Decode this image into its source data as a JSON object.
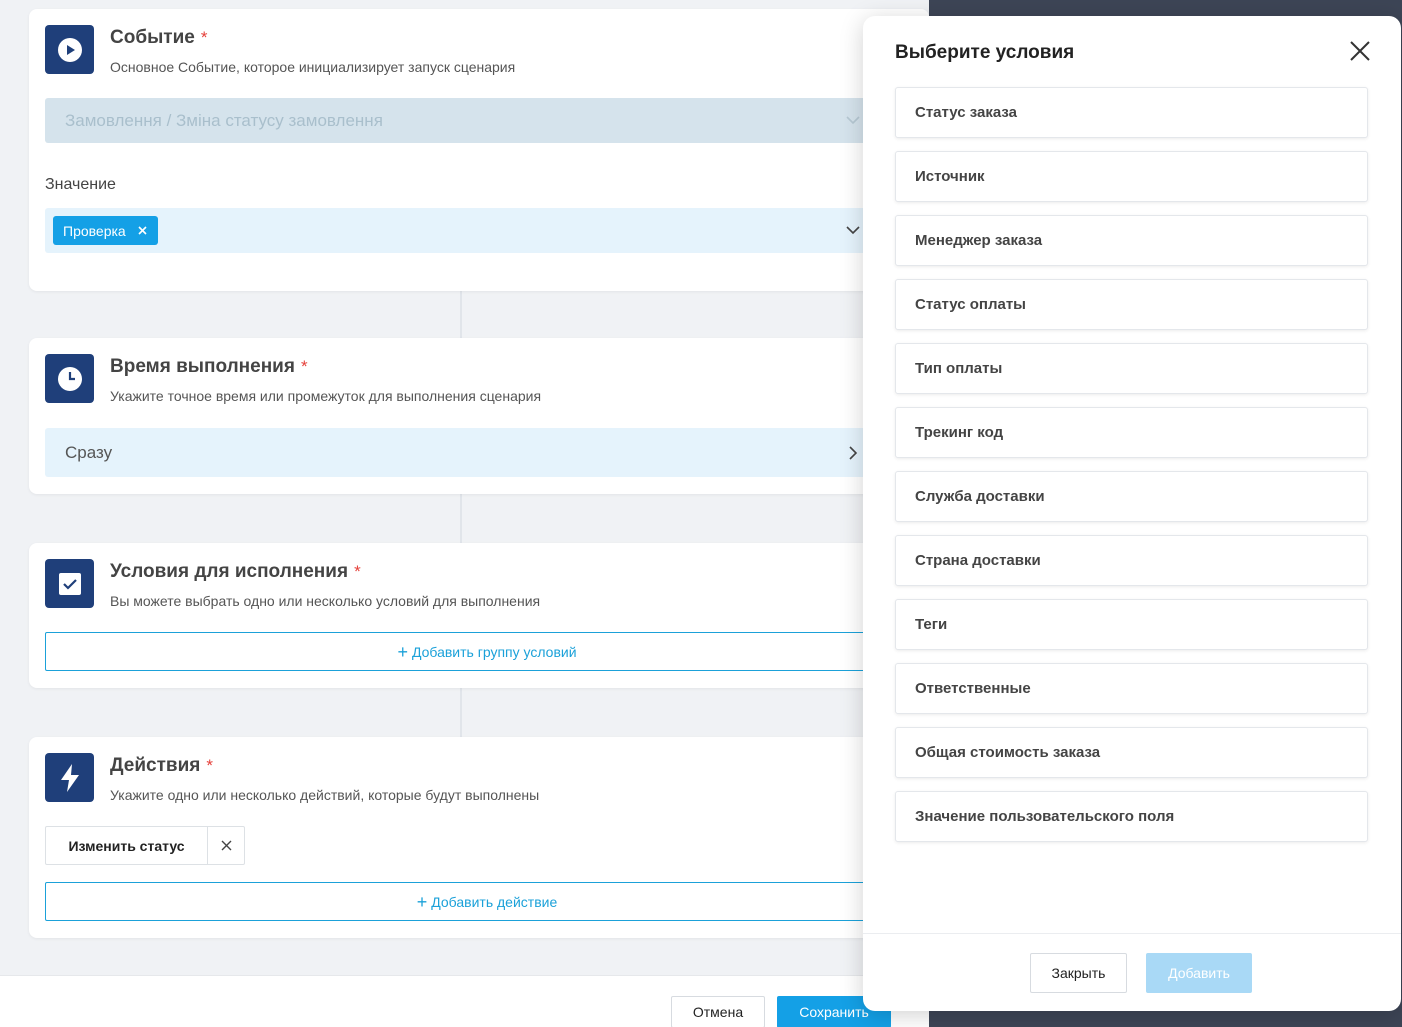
{
  "event": {
    "title": "Событие",
    "required_mark": "*",
    "subtitle": "Основное Событие, которое инициализирует запуск сценария",
    "event_select_value": "Замовлення / Зміна статусу замовлення",
    "value_label": "Значение",
    "value_tag": "Проверка"
  },
  "timing": {
    "title": "Время выполнения",
    "required_mark": "*",
    "subtitle": "Укажите точное время или промежуток для выполнения сценария",
    "value": "Сразу"
  },
  "conditions": {
    "title": "Условия для исполнения",
    "required_mark": "*",
    "subtitle": "Вы можете выбрать одно или несколько условий для выполнения",
    "add_group_plus": "+",
    "add_group_label": "Добавить группу условий"
  },
  "actions": {
    "title": "Действия",
    "required_mark": "*",
    "subtitle": "Укажите одно или несколько действий, которые будут выполнены",
    "action_chip_label": "Изменить статус",
    "add_action_plus": "+",
    "add_action_label": "Добавить действие"
  },
  "footer": {
    "cancel_label": "Отмена",
    "save_label": "Сохранить"
  },
  "modal": {
    "title": "Выберите условия",
    "items": [
      "Статус заказа",
      "Источник",
      "Менеджер заказа",
      "Статус оплаты",
      "Тип оплаты",
      "Трекинг код",
      "Служба доставки",
      "Страна доставки",
      "Теги",
      "Ответственные",
      "Общая стоимость заказа",
      "Значение пользовательского поля"
    ],
    "close_label": "Закрыть",
    "add_label": "Добавить"
  },
  "icons": {
    "event": "play-icon",
    "timing": "clock-icon",
    "conditions": "checkbox-icon",
    "actions": "lightning-icon"
  },
  "colors": {
    "primary": "#14a0e6",
    "icon_bg": "#1f3f7a",
    "required": "#e5403a",
    "dark_backdrop": "#3d4556"
  }
}
